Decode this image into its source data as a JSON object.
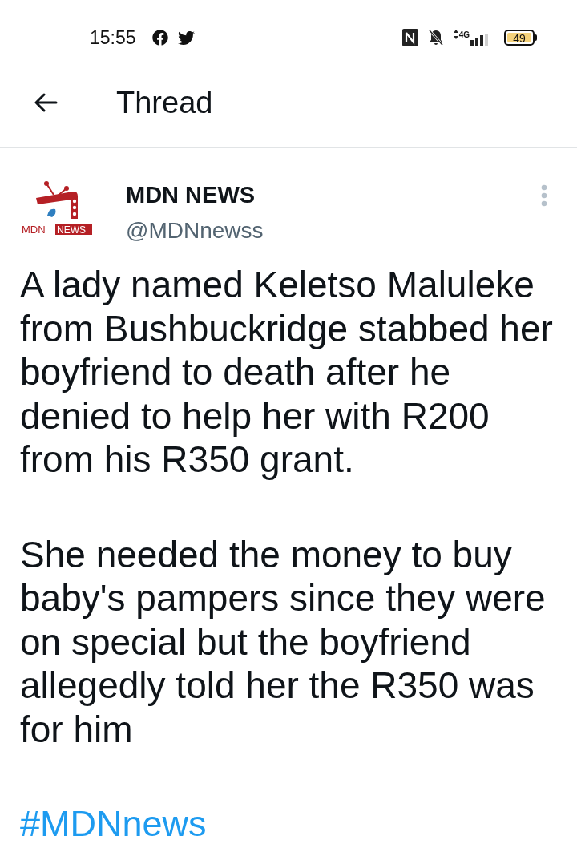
{
  "status_bar": {
    "time": "15:55",
    "network": "4G",
    "battery": "49"
  },
  "header": {
    "title": "Thread"
  },
  "tweet": {
    "author": {
      "name": "MDN NEWS",
      "handle": "@MDNnewss",
      "logo_text": [
        "MDN",
        "NEWS"
      ]
    },
    "paragraphs": [
      "A lady named Keletso Maluleke from Bushbuckridge stabbed her boyfriend to death after he denied to help her with R200 from his R350 grant.",
      "She needed the money to buy baby's pampers since they were on special but the boyfriend allegedly told her the R350 was for him"
    ],
    "hashtag": "#MDNnews"
  }
}
